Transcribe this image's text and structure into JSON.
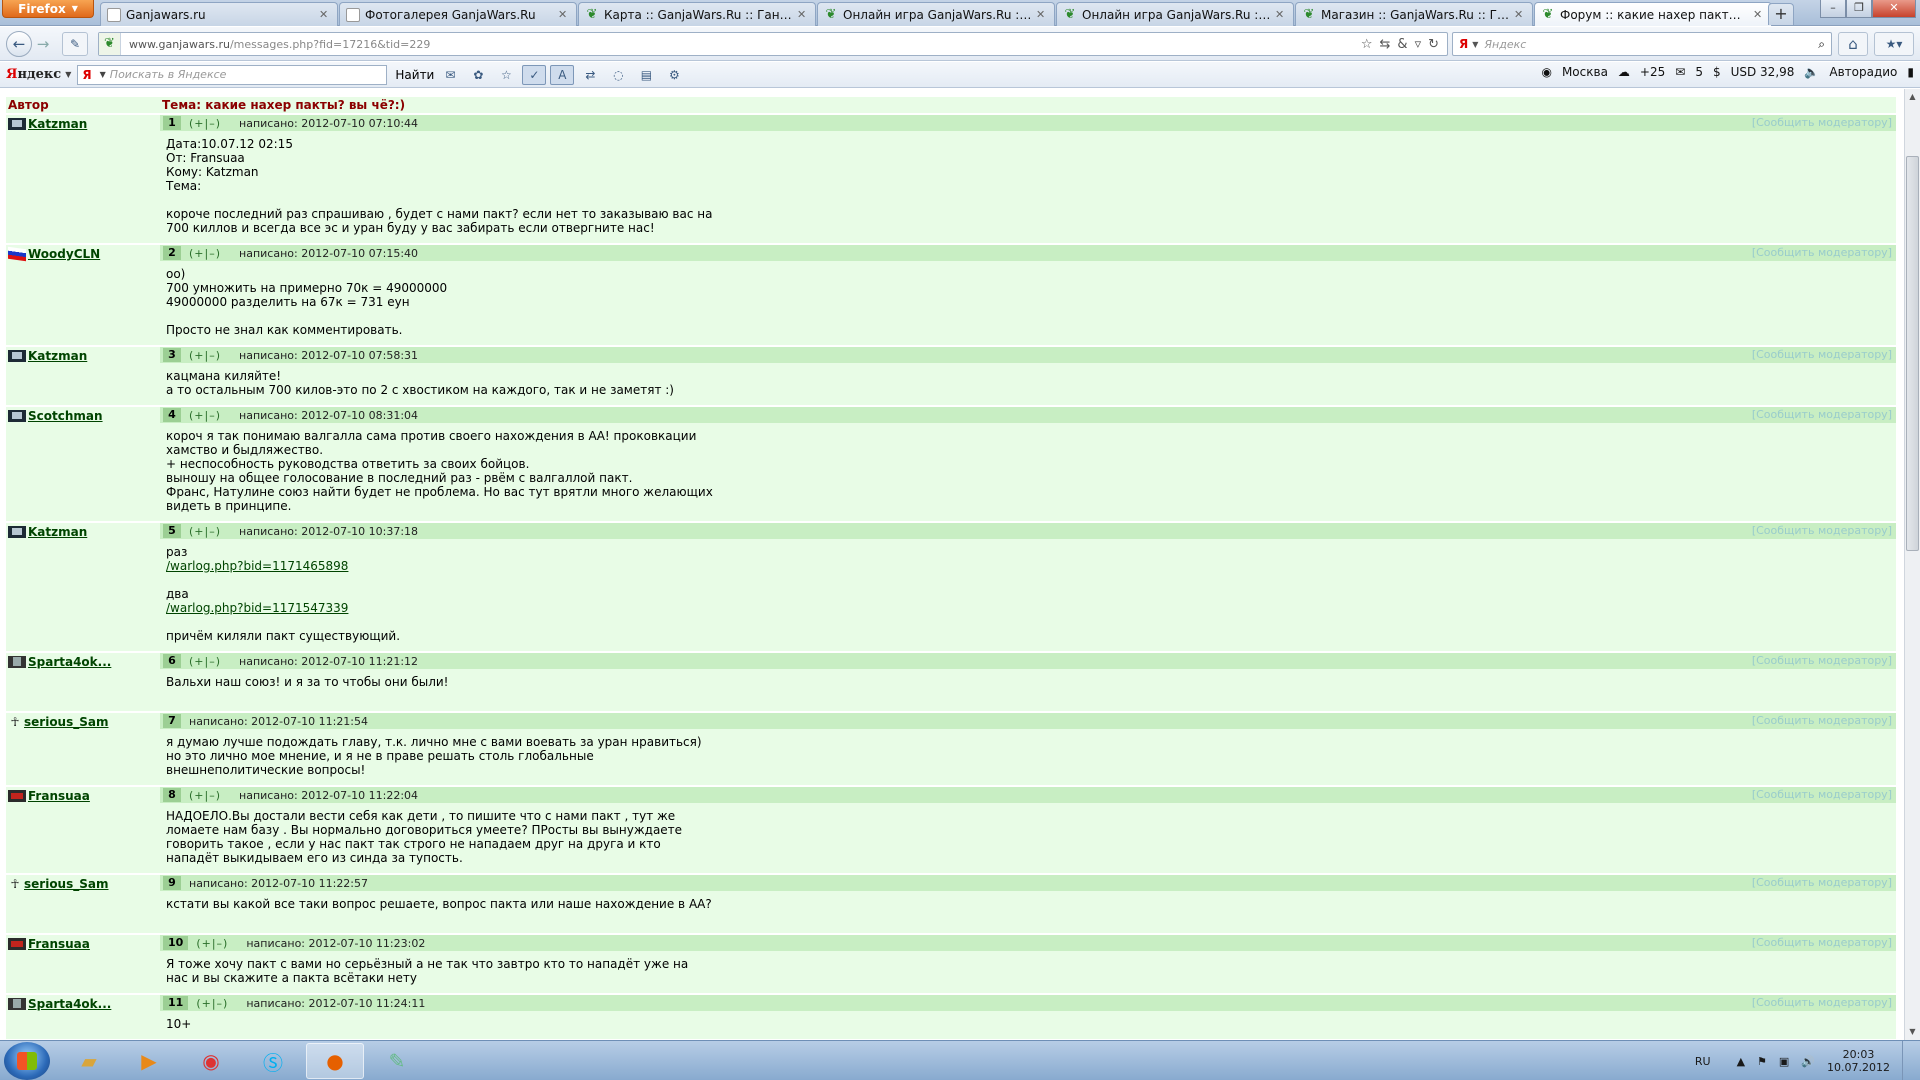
{
  "browser": {
    "app_button": "Firefox",
    "tabs": [
      {
        "label": "Ganjawars.ru",
        "icon": "page",
        "active": false
      },
      {
        "label": "Фотогалерея GanjaWars.Ru",
        "icon": "page",
        "active": false
      },
      {
        "label": "Карта :: GanjaWars.Ru :: Ганджуба...",
        "icon": "leaf",
        "active": false
      },
      {
        "label": "Онлайн игра GanjaWars.Ru :: Ганд...",
        "icon": "leaf",
        "active": false
      },
      {
        "label": "Онлайн игра GanjaWars.Ru :: Ганд...",
        "icon": "leaf",
        "active": false
      },
      {
        "label": "Магазин :: GanjaWars.Ru :: Ганджу...",
        "icon": "leaf",
        "active": false
      },
      {
        "label": "Форум :: какие нахер пакты? вы ч...",
        "icon": "leaf",
        "active": true
      }
    ],
    "url_host": "www.ganjawars.ru",
    "url_path": "/messages.php?fid=17216&tid=229",
    "search_placeholder": "Яндекс"
  },
  "yandex_bar": {
    "logo_red": "Я",
    "logo_rest": "ндекс",
    "search_placeholder": "Поискать в Яндексе",
    "find_label": "Найти",
    "city": "Москва",
    "weather": "+25",
    "mail_count": "5",
    "currency": "USD 32,98",
    "radio": "Авторадио"
  },
  "forum": {
    "author_header": "Автор",
    "topic_header": "Тема: какие нахер пакты? вы чё?:)",
    "report_label": "[Сообщить модератору]",
    "posts": [
      {
        "num": "1",
        "author": "Katzman",
        "avatar": "dark",
        "vote": "(+|–)",
        "written": "написано: 2012-07-10 07:10:44",
        "lines": [
          "Дата:10.07.12 02:15",
          "От: Fransuaa",
          "Кому: Katzman",
          "Тема:",
          "",
          "короче последний раз спрашиваю , будет с нами пакт? если нет то заказываю вас на",
          "700 киллов и всегда все эс и уран буду у вас забирать если отвергните нас!"
        ]
      },
      {
        "num": "2",
        "author": "WoodyCLN",
        "avatar": "flag",
        "vote": "(+|–)",
        "written": "написано: 2012-07-10 07:15:40",
        "lines": [
          "оо)",
          "700 умножить на примерно 70к = 49000000",
          "49000000 разделить на 67к = 731 еун",
          "",
          "Просто не знал как комментировать."
        ]
      },
      {
        "num": "3",
        "author": "Katzman",
        "avatar": "dark",
        "vote": "(+|–)",
        "written": "написано: 2012-07-10 07:58:31",
        "lines": [
          "кацмана киляйте!",
          "а то остальным 700 килов-это по 2 с хвостиком на каждого, так и не заметят :)"
        ]
      },
      {
        "num": "4",
        "author": "Scotchman",
        "avatar": "dark",
        "vote": "(+|–)",
        "written": "написано: 2012-07-10 08:31:04",
        "lines": [
          "короч я так понимаю валгалла сама против своего нахождения в АА! проковкации",
          "хамство и быдляжество.",
          "+ неспособность руководства ответить за своих бойцов.",
          "выношу на общее голосование в последний раз - рвём с валгаллой пакт.",
          "Франс, Натулине союз найти будет не проблема. Но вас тут врятли много желающих",
          "видеть в принципе."
        ]
      },
      {
        "num": "5",
        "author": "Katzman",
        "avatar": "dark",
        "vote": "(+|–)",
        "written": "написано: 2012-07-10 10:37:18",
        "lines": [
          "раз",
          "@link:/warlog.php?bid=1171465898",
          "",
          "два",
          "@link:/warlog.php?bid=1171547339",
          "",
          "причём киляли пакт существующий."
        ]
      },
      {
        "num": "6",
        "author": "Sparta4ok...",
        "avatar": "spart",
        "vote": "(+|–)",
        "written": "написано: 2012-07-10 11:21:12",
        "lines": [
          "Вальхи наш союз! и я за то чтобы они были!",
          ""
        ]
      },
      {
        "num": "7",
        "author": "serious_Sam",
        "avatar": "medal",
        "vote": "",
        "written": "написано: 2012-07-10 11:21:54",
        "lines": [
          "я думаю лучше подождать главу, т.к. лично мне с вами воевать за уран нравиться)",
          "но это лично мое мнение, и я не в праве решать столь глобальные",
          "внешнеполитические вопросы!"
        ]
      },
      {
        "num": "8",
        "author": "Fransuaa",
        "avatar": "red",
        "vote": "(+|–)",
        "written": "написано: 2012-07-10 11:22:04",
        "lines": [
          "НАДОЕЛО.Вы достали вести себя как дети , то пишите что с нами пакт , тут же",
          "ломаете нам базу . Вы нормально договориться умеете? ПРосты вы вынуждаете",
          "говорить такое , если у нас пакт так строго не нападаем друг на друга и кто",
          "нападёт выкидываем его из синда за тупость."
        ]
      },
      {
        "num": "9",
        "author": "serious_Sam",
        "avatar": "medal",
        "vote": "",
        "written": "написано: 2012-07-10 11:22:57",
        "lines": [
          "кстати вы какой все таки вопрос решаете, вопрос пакта или наше нахождение в АА?",
          ""
        ]
      },
      {
        "num": "10",
        "author": "Fransuaa",
        "avatar": "red",
        "vote": "(+|–)",
        "written": "написано: 2012-07-10 11:23:02",
        "lines": [
          "Я тоже хочу пакт с вами но серьёзный а не так что завтро кто то нападёт уже на",
          "нас и вы скажите а пакта всётаки нету"
        ]
      },
      {
        "num": "11",
        "author": "Sparta4ok...",
        "avatar": "spart",
        "vote": "(+|–)",
        "written": "написано: 2012-07-10 11:24:11",
        "lines": [
          "10+"
        ]
      }
    ]
  },
  "taskbar": {
    "lang": "RU",
    "time": "20:03",
    "date": "10.07.2012"
  },
  "colors": {
    "forum_bg": "#e8fce6",
    "post_header_bg": "#c8eec3",
    "header_red": "#8b0000",
    "author_green": "#004400"
  }
}
